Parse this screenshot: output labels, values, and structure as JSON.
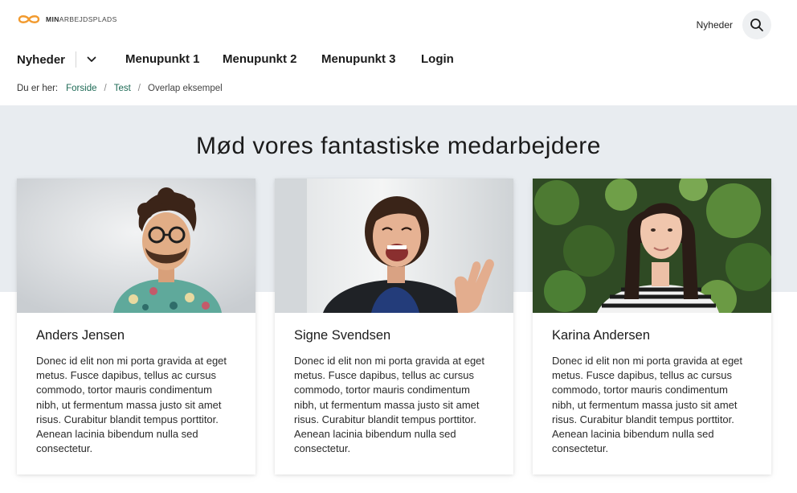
{
  "header": {
    "logo": {
      "text_bold": "MIN",
      "text_rest": "ARBEJDSPLADS",
      "accent_color": "#f29a2e"
    },
    "top_news_link": "Nyheder",
    "search_icon": "search-icon"
  },
  "nav": {
    "dropdown_label": "Nyheder",
    "dropdown_icon": "chevron-down-icon",
    "items": [
      {
        "label": "Menupunkt 1"
      },
      {
        "label": "Menupunkt 2"
      },
      {
        "label": "Menupunkt 3"
      },
      {
        "label": "Login"
      }
    ]
  },
  "breadcrumb": {
    "prefix": "Du er her:",
    "items": [
      {
        "label": "Forside"
      },
      {
        "label": "Test"
      },
      {
        "label": "Overlap eksempel"
      }
    ]
  },
  "section": {
    "title": "Mød vores fantastiske medarbejdere",
    "band_color": "#e8ecf0"
  },
  "employees": [
    {
      "name": "Anders Jensen",
      "text": "Donec id elit non mi porta gravida at eget metus. Fusce dapibus, tellus ac cursus commodo, tortor mauris condimentum nibh, ut fermentum massa justo sit amet risus. Curabitur blandit tempus porttitor. Aenean lacinia bibendum nulla sed consectetur."
    },
    {
      "name": "Signe Svendsen",
      "text": "Donec id elit non mi porta gravida at eget metus. Fusce dapibus, tellus ac cursus commodo, tortor mauris condimentum nibh, ut fermentum massa justo sit amet risus. Curabitur blandit tempus porttitor. Aenean lacinia bibendum nulla sed consectetur."
    },
    {
      "name": "Karina Andersen",
      "text": "Donec id elit non mi porta gravida at eget metus. Fusce dapibus, tellus ac cursus commodo, tortor mauris condimentum nibh, ut fermentum massa justo sit amet risus. Curabitur blandit tempus porttitor. Aenean lacinia bibendum nulla sed consectetur."
    }
  ]
}
